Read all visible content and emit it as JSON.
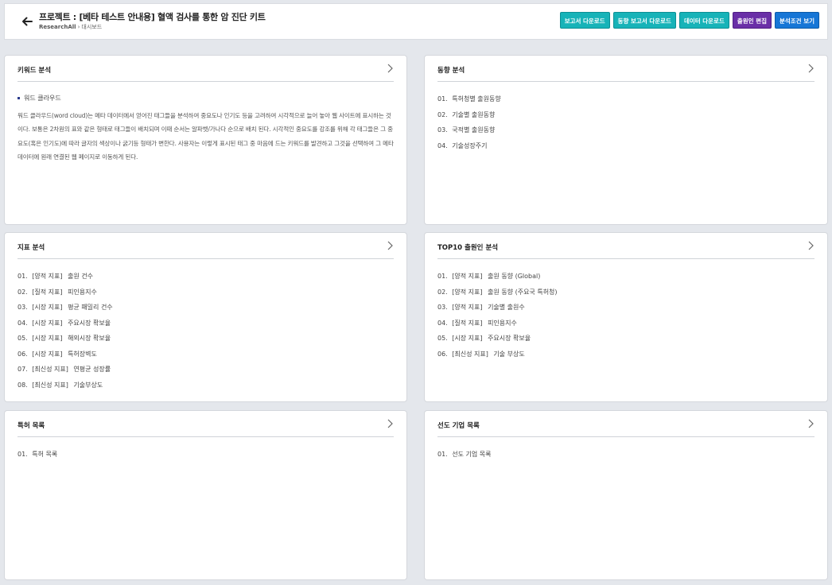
{
  "header": {
    "title": "프로젝트 : [베타 테스트 안내용] 혈액 검사를 통한 암 진단 키트",
    "breadcrumb": [
      "ResearchAll",
      "대시보드"
    ],
    "buttons": [
      {
        "label": "보고서 다운로드",
        "color": "#17b3b8"
      },
      {
        "label": "동향 보고서 다운로드",
        "color": "#17b3b8"
      },
      {
        "label": "데이터 다운로드",
        "color": "#17b3b8"
      },
      {
        "label": "출원인 편집",
        "color": "#6a2fa7"
      },
      {
        "label": "분석조건 보기",
        "color": "#1676d6"
      }
    ]
  },
  "cards": {
    "keyword": {
      "title": "키워드 분석",
      "subtitle": "워드 클라우드",
      "description": "워드 클라우드(word cloud)는 메타 데이터에서 얻어진 태그들을 분석하여 중요도나 인기도 등을 고려하여 시각적으로 늘어 놓아 웹 사이트에 표시하는 것이다. 보통은 2차원의 표와 같은 형태로 태그들이 배치되며 이때 순서는 알파벳/가나다 순으로 배치 된다. 시각적인 중요도를 강조를 위해 각 태그들은 그 중요도(혹은 인기도)에 따라 글자의 색상이나 굵기등 형태가 변한다. 사용자는 이렇게 표시된 태그 중 마음에 드는 키워드를 발견하고 그것을 선택하여 그 메타 데이터에 원래 연결된 웹 페이지로 이동하게 된다."
    },
    "trend": {
      "title": "동향 분석",
      "items": [
        {
          "num": "01.",
          "label": "특허청별 출원동향"
        },
        {
          "num": "02.",
          "label": "기술별 출원동향"
        },
        {
          "num": "03.",
          "label": "국적별 출원동향"
        },
        {
          "num": "04.",
          "label": "기술성장주기"
        }
      ]
    },
    "indicator": {
      "title": "지표 분석",
      "items": [
        {
          "num": "01.",
          "tag": "[양적 지표]",
          "label": "출원 건수"
        },
        {
          "num": "02.",
          "tag": "[질적 지표]",
          "label": "피인용지수"
        },
        {
          "num": "03.",
          "tag": "[시장 지표]",
          "label": "평균 패밀리 건수"
        },
        {
          "num": "04.",
          "tag": "[시장 지표]",
          "label": "주요시장 확보율"
        },
        {
          "num": "05.",
          "tag": "[시장 지표]",
          "label": "해외시장 확보율"
        },
        {
          "num": "06.",
          "tag": "[시장 지표]",
          "label": "특허장벽도"
        },
        {
          "num": "07.",
          "tag": "[최신성 지표]",
          "label": "연평균 성장률"
        },
        {
          "num": "08.",
          "tag": "[최신성 지표]",
          "label": "기술부상도"
        }
      ]
    },
    "top10": {
      "title": "TOP10 출원인 분석",
      "items": [
        {
          "num": "01.",
          "tag": "[양적 지표]",
          "label": "출원 동향 (Global)"
        },
        {
          "num": "02.",
          "tag": "[양적 지표]",
          "label": "출원 동향 (주요국 특허청)"
        },
        {
          "num": "03.",
          "tag": "[양적 지표]",
          "label": "기술별 출원수"
        },
        {
          "num": "04.",
          "tag": "[질적 지표]",
          "label": "피인용지수"
        },
        {
          "num": "05.",
          "tag": "[시장 지표]",
          "label": "주요시장 확보율"
        },
        {
          "num": "06.",
          "tag": "[최신성 지표]",
          "label": "기술 부상도"
        }
      ]
    },
    "patents": {
      "title": "특허 목록",
      "items": [
        {
          "num": "01.",
          "label": "특허 목록"
        }
      ]
    },
    "leaders": {
      "title": "선도 기업 목록",
      "items": [
        {
          "num": "01.",
          "label": "선도 기업 목록"
        }
      ]
    }
  }
}
